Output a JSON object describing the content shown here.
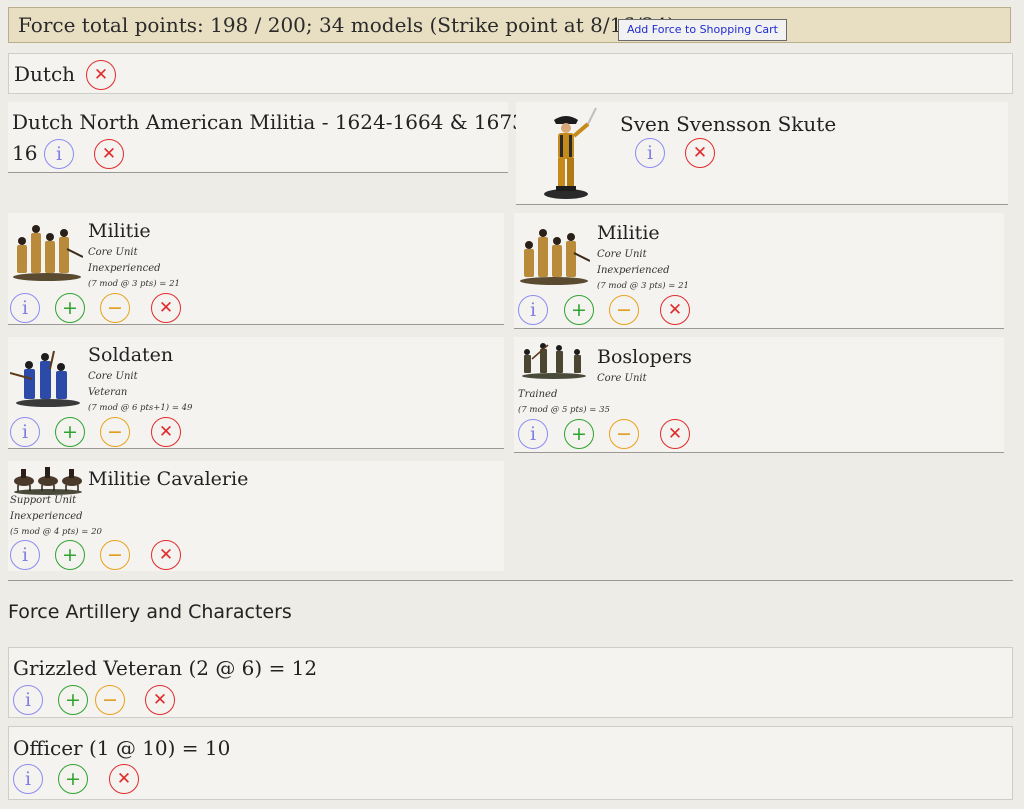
{
  "header": {
    "force_total": "Force total points: 198 / 200; 34 models (Strike point at 8/16/24)",
    "cart_button": "Add Force to Shopping Cart"
  },
  "nation": {
    "name": "Dutch"
  },
  "force": {
    "name_line1": "Dutch North American Militia - 1624-1664 & 1673-",
    "name_line2": "16"
  },
  "commander": {
    "name": "Sven Svensson Skute"
  },
  "icons": {
    "info": "i",
    "add": "+",
    "remove": "−",
    "delete": "✕"
  },
  "units": [
    {
      "name": "Militie",
      "type": "Core Unit",
      "experience": "Inexperienced",
      "cost": "(7 mod @ 3 pts) = 21"
    },
    {
      "name": "Militie",
      "type": "Core Unit",
      "experience": "Inexperienced",
      "cost": "(7 mod @ 3 pts) = 21"
    },
    {
      "name": "Soldaten",
      "type": "Core Unit",
      "experience": "Veteran",
      "cost": "(7 mod @ 6 pts+1) = 49"
    },
    {
      "name": "Boslopers",
      "type": "Core Unit",
      "experience": "Trained",
      "cost": "(7 mod @ 5 pts) = 35"
    },
    {
      "name": "Militie Cavalerie",
      "type": "Support Unit",
      "experience": "Inexperienced",
      "cost": "(5 mod @ 4 pts) = 20"
    }
  ],
  "artillery_section": {
    "title": "Force Artillery and Characters"
  },
  "characters": [
    {
      "label": "Grizzled Veteran (2 @ 6) = 12"
    },
    {
      "label": "Officer (1 @ 10) = 10"
    }
  ],
  "colors": {
    "info": "#7f7fe6",
    "add": "#2ea32e",
    "remove": "#e39a14",
    "delete": "#e12b2b",
    "header_bg": "#e8dfc3",
    "cart_text": "#1f2bd1"
  }
}
